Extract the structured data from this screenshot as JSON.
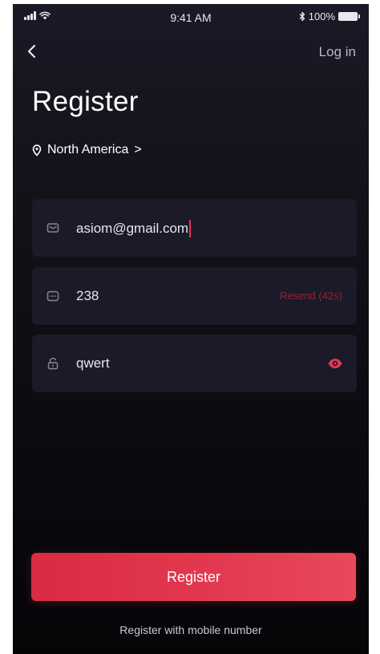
{
  "status_bar": {
    "time": "9:41 AM",
    "battery": "100%"
  },
  "nav": {
    "back_icon": "chevron-left-icon",
    "login_label": "Log in"
  },
  "page": {
    "title": "Register"
  },
  "region": {
    "icon": "location-pin-icon",
    "label": "North America",
    "arrow": ">"
  },
  "fields": {
    "email": {
      "icon": "mail-icon",
      "value": "asiom@gmail.com"
    },
    "code": {
      "icon": "message-code-icon",
      "value": "238",
      "resend_label": "Resend (42s)"
    },
    "password": {
      "icon": "lock-icon",
      "value": "qwert",
      "toggle_icon": "eye-icon"
    }
  },
  "actions": {
    "register_label": "Register",
    "alt_register_label": "Register with mobile number"
  },
  "colors": {
    "accent": "#e23a52",
    "background": "#0a0a10",
    "field_bg": "#1a1a28"
  }
}
